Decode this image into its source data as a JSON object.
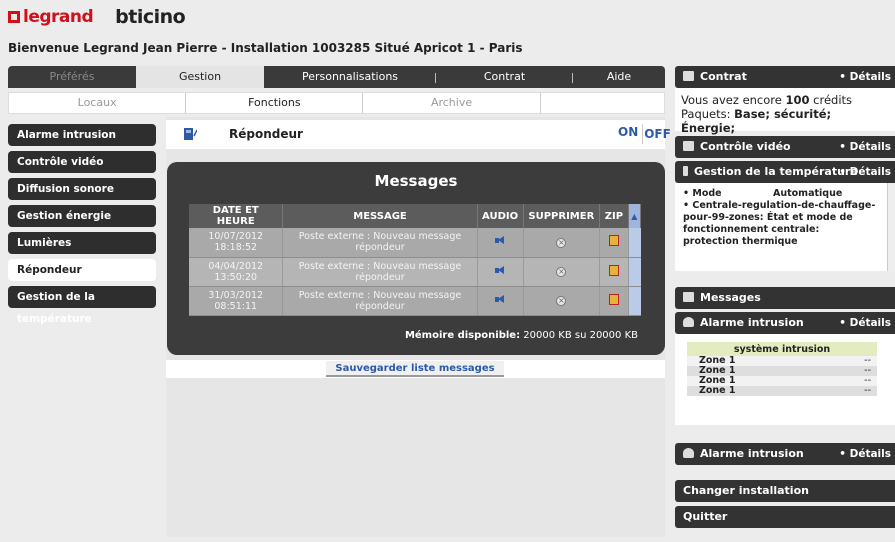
{
  "brand": {
    "legrand": "legrand",
    "bticino": "bticino"
  },
  "welcome": "Bienvenue Legrand Jean Pierre - Installation 1003285 Situé Apricot 1 - Paris",
  "main_tabs": [
    {
      "label": "Préférés",
      "state": "disabled"
    },
    {
      "label": "Gestion",
      "state": "active"
    },
    {
      "label": "Personnalisations",
      "state": "normal"
    },
    {
      "label": "Contrat",
      "state": "normal"
    },
    {
      "label": "Aide",
      "state": "normal"
    }
  ],
  "sub_tabs": [
    {
      "label": "Locaux",
      "state": "disabled"
    },
    {
      "label": "Fonctions",
      "state": "active"
    },
    {
      "label": "Archive",
      "state": "disabled"
    },
    {
      "label": "",
      "state": "disabled"
    }
  ],
  "left_menu": [
    "Alarme intrusion",
    "Contrôle vidéo",
    "Diffusion sonore",
    "Gestion énergie",
    "Lumières",
    "Répondeur",
    "Gestion de la température"
  ],
  "left_menu_active": "Répondeur",
  "repondeur": {
    "title": "Répondeur",
    "on": "ON",
    "off": "OFF"
  },
  "messages": {
    "title": "Messages",
    "columns": [
      "DATE ET HEURE",
      "MESSAGE",
      "AUDIO",
      "SUPPRIMER",
      "ZIP"
    ],
    "rows": [
      {
        "date": "10/07/2012",
        "time": "18:18:52",
        "message": "Poste externe : Nouveau message répondeur"
      },
      {
        "date": "04/04/2012",
        "time": "13:50:20",
        "message": "Poste externe : Nouveau message répondeur"
      },
      {
        "date": "31/03/2012",
        "time": "08:51:11",
        "message": "Poste externe : Nouveau message répondeur"
      }
    ],
    "memory_label": "Mémoire disponible:",
    "memory_value": "20000 KB su 20000 KB",
    "save_button": "Sauvegarder liste messages"
  },
  "right": {
    "details": "• Détails",
    "contrat": {
      "title": "Contrat",
      "line1_pre": "Vous avez encore ",
      "line1_bold": "100",
      "line1_post": " crédits",
      "line2_pre": "Paquets: ",
      "line2_bold": "Base; sécurité; Énergie;"
    },
    "controle_video": "Contrôle vidéo",
    "gestion_temp": {
      "title": "Gestion de la température",
      "mode_label": "• Mode",
      "mode_value": "Automatique",
      "zone_text": "• Centrale-regulation-de-chauffage-pour-99-zones: État et mode de fonctionnement centrale: protection thermique"
    },
    "messages_title": "Messages",
    "alarme": {
      "title": "Alarme intrusion",
      "table_header": "système intrusion",
      "zones": [
        {
          "name": "Zone 1",
          "value": "--"
        },
        {
          "name": "Zone 1",
          "value": "--"
        },
        {
          "name": "Zone 1",
          "value": "--"
        },
        {
          "name": "Zone 1",
          "value": "--"
        }
      ]
    },
    "alarme2_title": "Alarme intrusion",
    "changer": "Changer installation",
    "quitter": "Quitter"
  }
}
